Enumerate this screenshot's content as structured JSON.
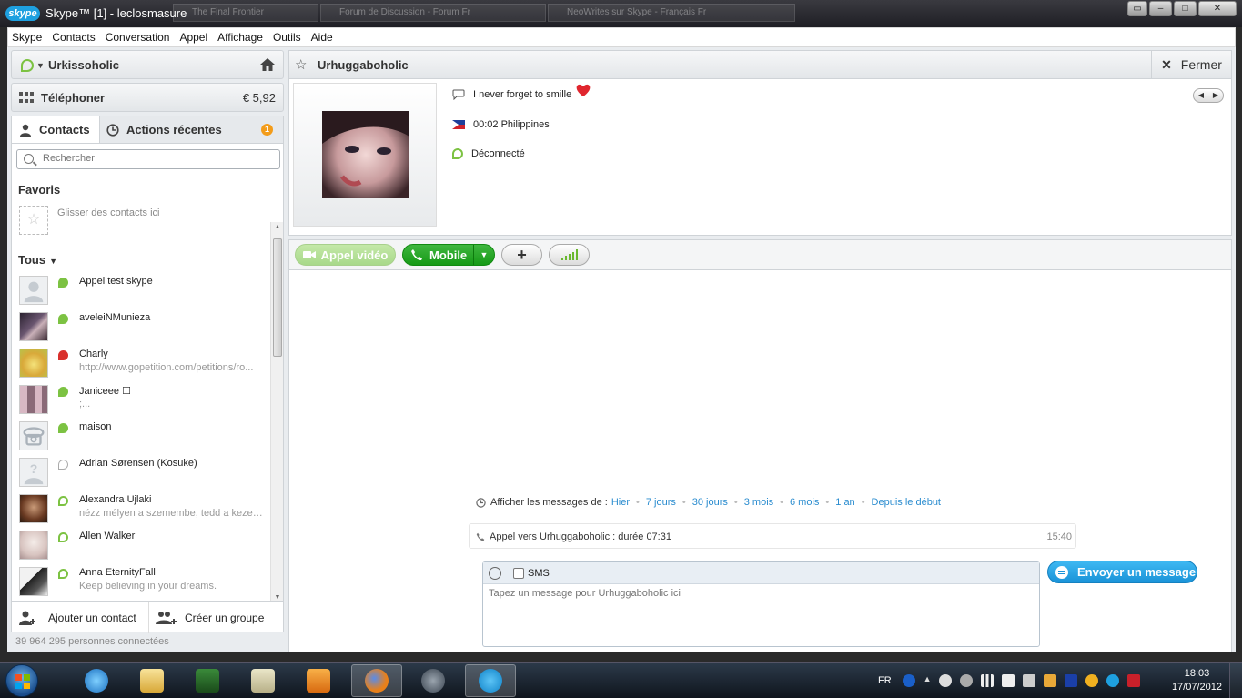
{
  "window": {
    "logo": "skype",
    "title": "Skype™ [1] - leclosmasure",
    "background_tabs": [
      "The Final Frontier",
      "Forum de Discussion - Forum Fr",
      "NeoWrites sur Skype - Français Fr"
    ],
    "controls": [
      "minimize",
      "maximize",
      "close"
    ]
  },
  "menu": [
    "Skype",
    "Contacts",
    "Conversation",
    "Appel",
    "Affichage",
    "Outils",
    "Aide"
  ],
  "sidebar": {
    "user_name": "Urkissoholic",
    "call_label": "Téléphoner",
    "credit": "€ 5,92",
    "tabs": {
      "contacts": "Contacts",
      "recent": "Actions récentes",
      "recent_badge": "1"
    },
    "search_placeholder": "Rechercher",
    "favorites_title": "Favoris",
    "favorites_hint": "Glisser des contacts ici",
    "all_title": "Tous",
    "contacts": [
      {
        "name": "Appel test skype",
        "mood": "",
        "status": "online",
        "avatar": "default"
      },
      {
        "name": "aveleiNMunieza",
        "mood": "",
        "status": "online",
        "avatar": "photo"
      },
      {
        "name": "Charly",
        "mood": "http://www.gopetition.com/petitions/ro...",
        "status": "busy",
        "avatar": "cartoon"
      },
      {
        "name": "Janiceee ☐",
        "mood": ";...",
        "status": "online",
        "avatar": "photo"
      },
      {
        "name": "maison",
        "mood": "",
        "status": "online",
        "avatar": "phone"
      },
      {
        "name": "Adrian Sørensen (Kosuke)",
        "mood": "",
        "status": "unknown",
        "avatar": "unknown"
      },
      {
        "name": "Alexandra Ujlaki",
        "mood": "nézz mélyen a szemembe, tedd a kezed...",
        "status": "offline",
        "avatar": "photo"
      },
      {
        "name": "Allen Walker",
        "mood": "",
        "status": "offline",
        "avatar": "photo"
      },
      {
        "name": "Anna EternityFall",
        "mood": "Keep believing in your dreams.",
        "status": "offline",
        "avatar": "photo"
      }
    ],
    "add_contact": "Ajouter un contact",
    "create_group": "Créer un groupe",
    "connected_count": "39 964 295 personnes connectées"
  },
  "chat": {
    "contact_name": "Urhuggaboholic",
    "close_label": "Fermer",
    "mood": "I never forget to smille",
    "local_time": "00:02 Philippines",
    "status": "Déconnecté",
    "buttons": {
      "video": "Appel vidéo",
      "mobile": "Mobile"
    },
    "history_label": "Afficher les messages de :",
    "history_links": [
      "Hier",
      "7 jours",
      "30 jours",
      "3 mois",
      "6 mois",
      "1 an",
      "Depuis le début"
    ],
    "call_text": "Appel vers Urhuggaboholic : durée 07:31",
    "call_time": "15:40",
    "sms_label": "SMS",
    "message_placeholder": "Tapez un message pour Urhuggaboholic ici",
    "send_label": "Envoyer un message"
  },
  "taskbar": {
    "language": "FR",
    "time": "18:03",
    "date": "17/07/2012",
    "apps": [
      "internet-explorer",
      "file-explorer",
      "game",
      "folder",
      "media-player",
      "firefox",
      "steam",
      "skype"
    ]
  },
  "colors": {
    "online": "#7cc242",
    "busy": "#d9302c",
    "link": "#2a8ccf",
    "send": "#1a93d8",
    "call_green": "#169a16"
  }
}
